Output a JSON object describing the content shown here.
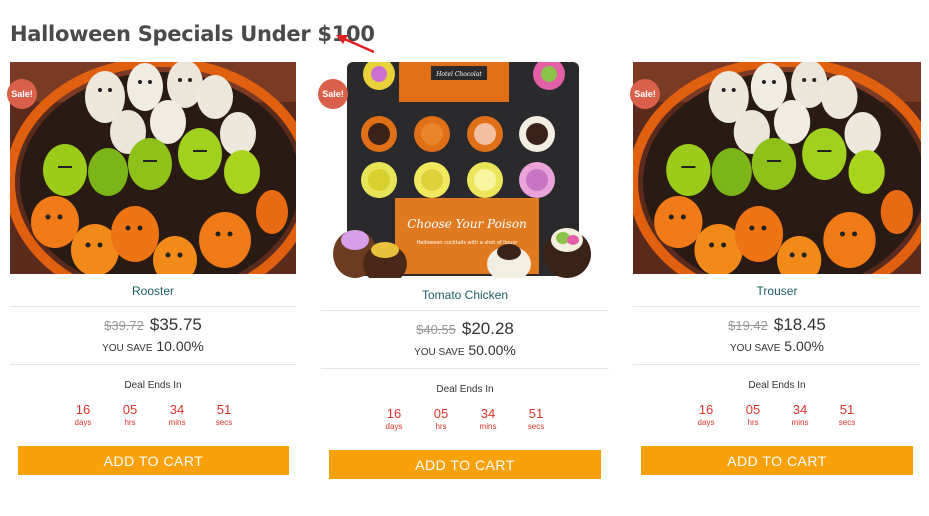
{
  "section": {
    "title": "Halloween Specials Under $100"
  },
  "products": [
    {
      "sale_badge": "Sale!",
      "name": "Rooster",
      "old_price": "$39.72",
      "new_price": "$35.75",
      "you_save_label": "YOU SAVE",
      "you_save_value": "10.00%",
      "deal_label": "Deal Ends In",
      "countdown": [
        {
          "num": "16",
          "unit": "days"
        },
        {
          "num": "05",
          "unit": "hrs"
        },
        {
          "num": "34",
          "unit": "mins"
        },
        {
          "num": "51",
          "unit": "secs"
        }
      ],
      "button": "ADD TO CART",
      "image": "halloween-strawberries"
    },
    {
      "sale_badge": "Sale!",
      "name": "Tomato Chicken",
      "old_price": "$40.55",
      "new_price": "$20.28",
      "you_save_label": "YOU SAVE",
      "you_save_value": "50.00%",
      "deal_label": "Deal Ends In",
      "countdown": [
        {
          "num": "16",
          "unit": "days"
        },
        {
          "num": "05",
          "unit": "hrs"
        },
        {
          "num": "34",
          "unit": "mins"
        },
        {
          "num": "51",
          "unit": "secs"
        }
      ],
      "button": "ADD TO CART",
      "image": "halloween-chocolates",
      "image_text": {
        "brand": "Hotel Chocolat",
        "card": "Choose Your Poison",
        "card_sub": "Halloween cocktails with a shot of liquor"
      }
    },
    {
      "sale_badge": "Sale!",
      "name": "Trouser",
      "old_price": "$19.42",
      "new_price": "$18.45",
      "you_save_label": "YOU SAVE",
      "you_save_value": "5.00%",
      "deal_label": "Deal Ends In",
      "countdown": [
        {
          "num": "16",
          "unit": "days"
        },
        {
          "num": "05",
          "unit": "hrs"
        },
        {
          "num": "34",
          "unit": "mins"
        },
        {
          "num": "51",
          "unit": "secs"
        }
      ],
      "button": "ADD TO CART",
      "image": "halloween-strawberries"
    }
  ],
  "colors": {
    "accent_button": "#f9a10a",
    "sale_badge": "#d9604a",
    "countdown": "#d9342b",
    "product_name": "#1d5f66",
    "arrow": "#e02020"
  }
}
